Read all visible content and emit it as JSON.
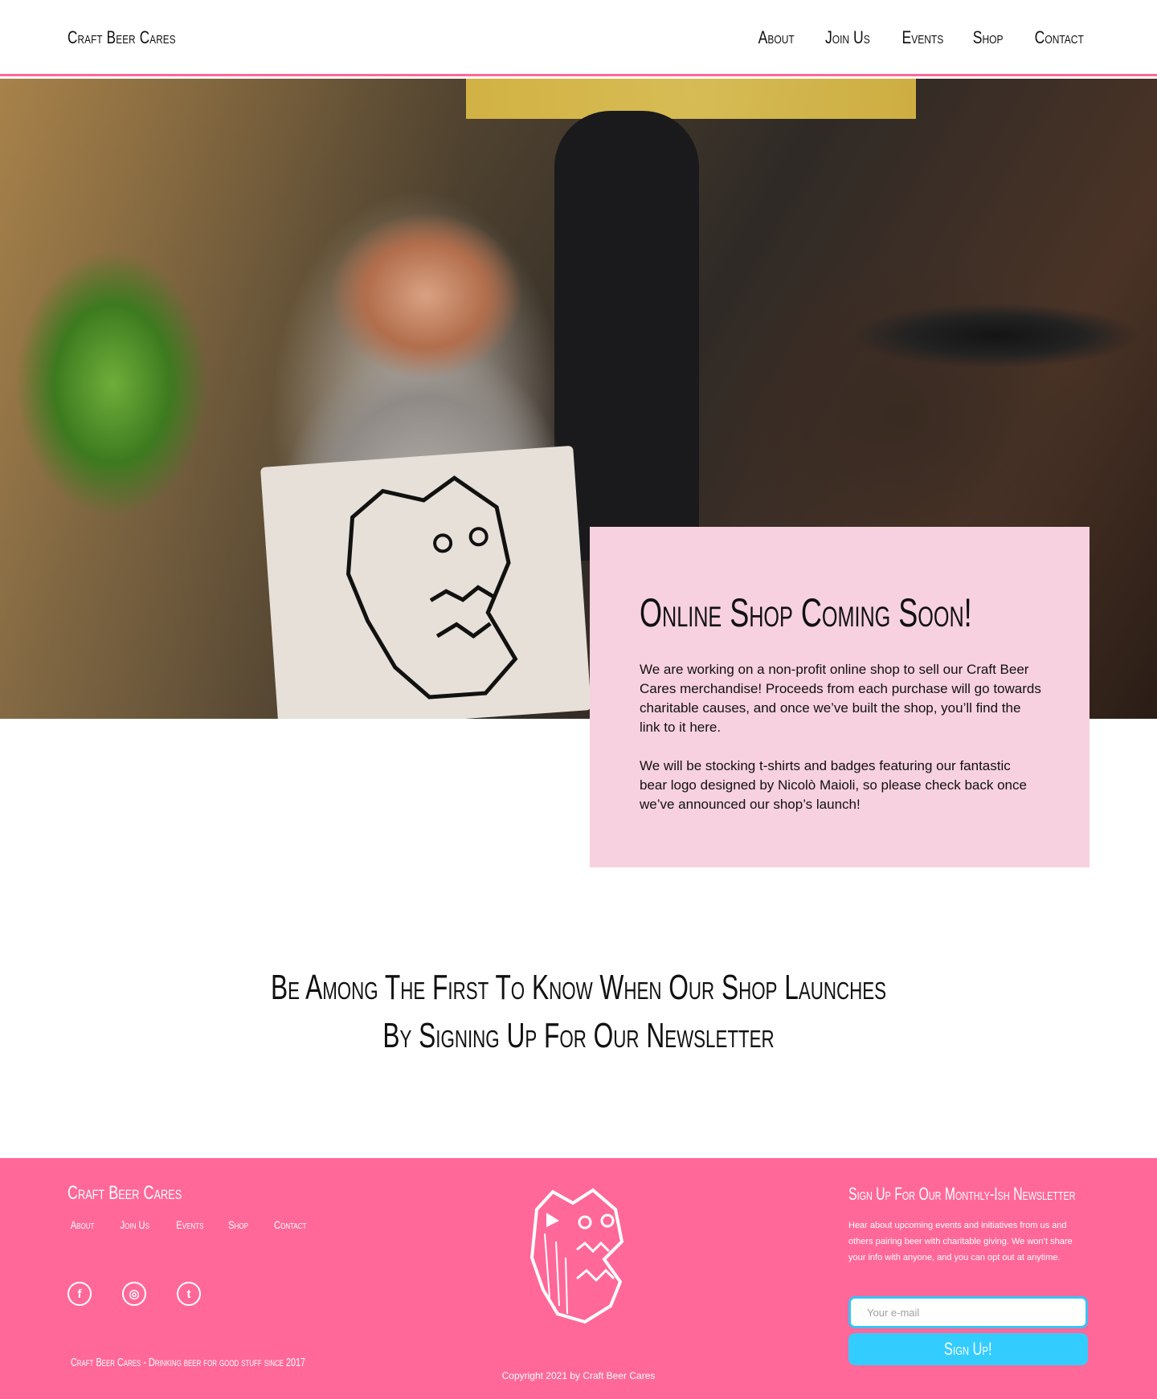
{
  "header": {
    "brand": "Craft Beer Cares",
    "nav": [
      "About",
      "Join Us",
      "Events",
      "Shop",
      "Contact"
    ]
  },
  "card": {
    "title": "Online Shop Coming Soon!",
    "paragraph1": "We are working on a non-profit online shop to sell our Craft Beer Cares merchandise! Proceeds from each purchase will go towards charitable causes, and once we’ve built the shop, you’ll find the link to it here.",
    "paragraph2": "We will be stocking t-shirts and badges featuring our fantastic bear logo designed by Nicolò Maioli, so please check back once we’ve announced our shop’s launch!"
  },
  "callout": {
    "line1": "Be Among The First To Know When Our Shop Launches",
    "line2": "By Signing Up For Our Newsletter"
  },
  "footer": {
    "brand": "Craft Beer Cares",
    "nav": [
      "About",
      "Join Us",
      "Events",
      "Shop",
      "Contact"
    ],
    "social": [
      {
        "name": "facebook-icon",
        "glyph": "f"
      },
      {
        "name": "instagram-icon",
        "glyph": "◎"
      },
      {
        "name": "twitter-icon",
        "glyph": "t"
      }
    ],
    "tagline": "Craft Beer Cares - Drinking beer for good stuff since 2017",
    "copyright": "Copyright 2021 by Craft Beer Cares",
    "newsletter": {
      "title": "Sign Up For Our Monthly-Ish Newsletter",
      "text": "Hear about upcoming events and initiatives from us and others pairing beer with charitable giving. We won’t share your info with anyone, and you can opt out at anytime.",
      "placeholder": "Your e-mail",
      "button": "Sign Up!"
    }
  },
  "colors": {
    "accent_pink": "#ff6898",
    "card_pink": "#f7d1df",
    "button_blue": "#33ccff"
  }
}
